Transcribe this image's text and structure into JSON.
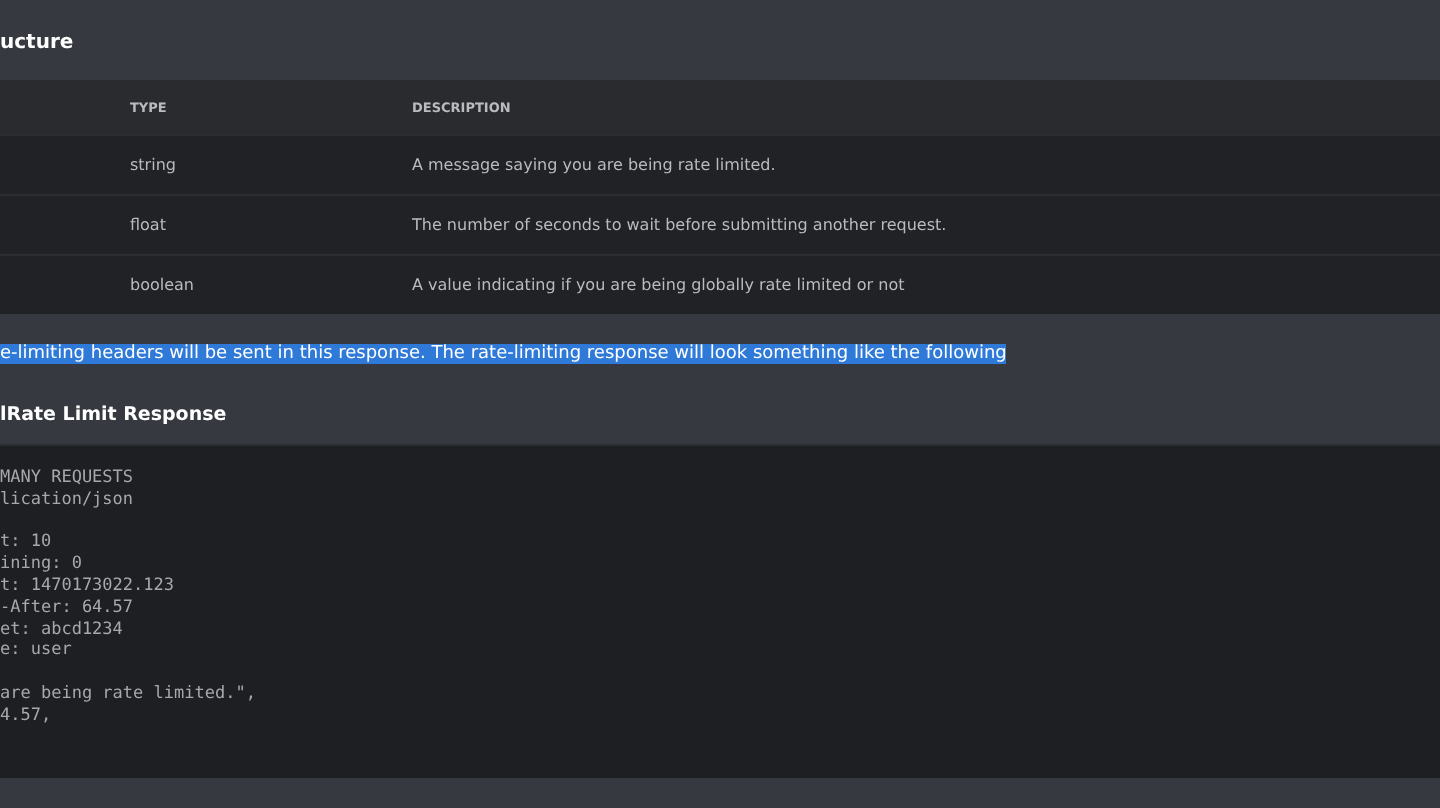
{
  "section_heading": "ucture",
  "table": {
    "columns": [
      "",
      "TYPE",
      "DESCRIPTION"
    ],
    "rows": [
      {
        "type": "string",
        "description": "A message saying you are being rate limited."
      },
      {
        "type": "float",
        "description": "The number of seconds to wait before submitting another request."
      },
      {
        "type": "boolean",
        "description": "A value indicating if you are being globally rate limited or not"
      }
    ]
  },
  "paragraph": {
    "text": "e-limiting headers will be sent in this response. The rate-limiting response will look something like the following",
    "selected": true
  },
  "example_heading": "lRate Limit Response",
  "code_blocks": [
    [
      "MANY REQUESTS",
      "lication/json"
    ],
    [
      "t: 10",
      "ining: 0",
      "t: 1470173022.123",
      "-After: 64.57",
      "et: abcd1234",
      "e: user"
    ],
    [
      "are being rate limited.\",",
      "4.57,"
    ]
  ]
}
